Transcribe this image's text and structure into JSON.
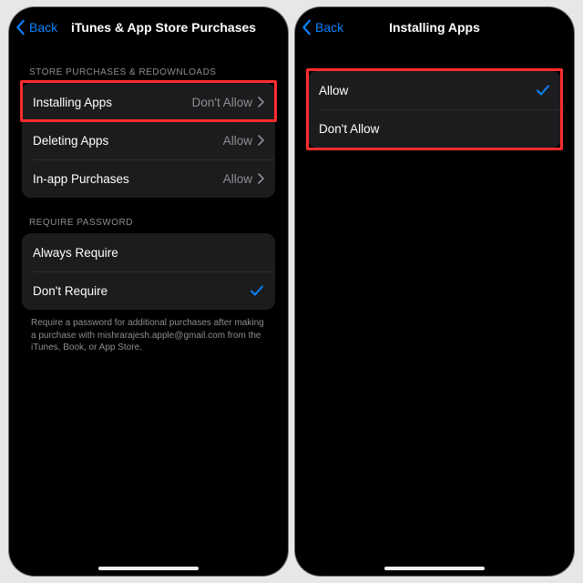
{
  "colors": {
    "accent": "#0a84ff",
    "highlight": "#ff2d2d"
  },
  "left": {
    "back_label": "Back",
    "title": "iTunes & App Store Purchases",
    "section1_header": "STORE PURCHASES & REDOWNLOADS",
    "rows1": [
      {
        "label": "Installing Apps",
        "value": "Don't Allow"
      },
      {
        "label": "Deleting Apps",
        "value": "Allow"
      },
      {
        "label": "In-app Purchases",
        "value": "Allow"
      }
    ],
    "section2_header": "REQUIRE PASSWORD",
    "rows2": [
      {
        "label": "Always Require",
        "checked": false
      },
      {
        "label": "Don't Require",
        "checked": true
      }
    ],
    "footer": "Require a password for additional purchases after making a purchase with mishrarajesh.apple@gmail.com from the iTunes, Book, or App Store."
  },
  "right": {
    "back_label": "Back",
    "title": "Installing Apps",
    "rows": [
      {
        "label": "Allow",
        "checked": true
      },
      {
        "label": "Don't Allow",
        "checked": false
      }
    ]
  }
}
